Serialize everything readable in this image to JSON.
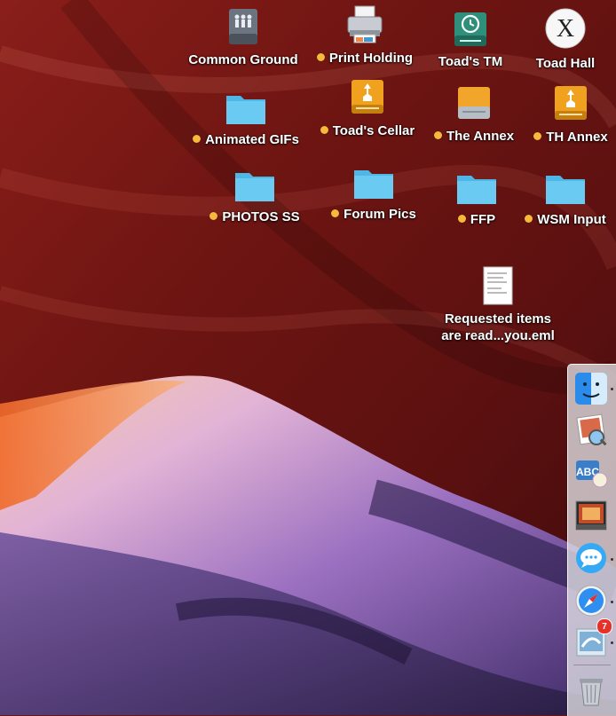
{
  "desktop": {
    "icons": [
      {
        "label": "Common Ground",
        "icon": "server-icon",
        "tagged": false
      },
      {
        "label": "Print Holding",
        "icon": "printer-icon",
        "tagged": true
      },
      {
        "label": "Toad's TM",
        "icon": "time-machine-drive-icon",
        "tagged": false
      },
      {
        "label": "Toad Hall",
        "icon": "macos-x-disk-icon",
        "tagged": false
      },
      {
        "label": "Animated GIFs",
        "icon": "folder-icon",
        "tagged": true
      },
      {
        "label": "Toad's Cellar",
        "icon": "firewire-drive-icon",
        "tagged": true
      },
      {
        "label": "The Annex",
        "icon": "external-drive-icon",
        "tagged": true
      },
      {
        "label": "TH Annex",
        "icon": "firewire-drive-icon",
        "tagged": true
      },
      {
        "label": "PHOTOS SS",
        "icon": "folder-icon",
        "tagged": true
      },
      {
        "label": "Forum Pics",
        "icon": "folder-icon",
        "tagged": true
      },
      {
        "label": "FFP",
        "icon": "folder-icon",
        "tagged": true
      },
      {
        "label": "WSM Input",
        "icon": "folder-icon",
        "tagged": true
      },
      {
        "label": "Requested items\nare read...you.eml",
        "icon": "email-document-icon",
        "tagged": false
      }
    ]
  },
  "dock": {
    "items": [
      {
        "name": "finder",
        "icon": "finder-icon",
        "running": true
      },
      {
        "name": "preview",
        "icon": "preview-icon",
        "running": false
      },
      {
        "name": "font-book",
        "icon": "font-book-icon",
        "running": false
      },
      {
        "name": "photo-booth",
        "icon": "photo-booth-icon",
        "running": false
      },
      {
        "name": "messages",
        "icon": "messages-icon",
        "running": true
      },
      {
        "name": "safari",
        "icon": "safari-icon",
        "running": true
      },
      {
        "name": "mail",
        "icon": "mail-icon",
        "running": true,
        "badge": "7"
      },
      {
        "name": "trash",
        "icon": "trash-icon",
        "running": false
      }
    ]
  },
  "colors": {
    "tag": "#f6b93b",
    "folder": "#5ec8f2",
    "badge": "#e8302a"
  }
}
